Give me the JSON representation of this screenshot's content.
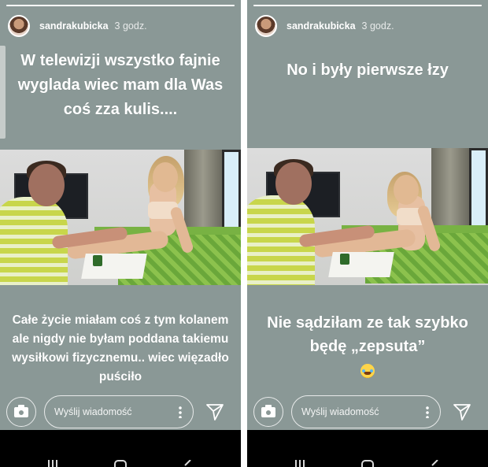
{
  "stories": [
    {
      "username": "sandrakubicka",
      "time": "3 godz.",
      "progress": 1.0,
      "caption_top": "W telewizji wszystko fajnie wyglada wiec mam dla Was coś zza kulis....",
      "caption_bottom": "Całe życie miałam coś z tym kolanem ale nigdy nie byłam poddana takiemu wysiłkowi fizycznemu.. wiec więzadło puściło",
      "reply_placeholder": "Wyślij wiadomość"
    },
    {
      "username": "sandrakubicka",
      "time": "3 godz.",
      "progress": 1.0,
      "caption_top": "No i były pierwsze łzy",
      "caption_bottom": "Nie sądziłam ze tak szybko będę „zepsuta”",
      "caption_bottom_emoji": "face-with-tears-of-joy-icon",
      "reply_placeholder": "Wyślij wiadomość"
    }
  ],
  "icons": {
    "camera": "camera-icon",
    "more": "more-vertical-icon",
    "send": "send-icon",
    "nav_recent": "recent-apps-icon",
    "nav_home": "home-icon",
    "nav_back": "back-icon"
  },
  "colors": {
    "story_background": "#8a9896",
    "text": "#ffffff",
    "nav_bar": "#000000"
  }
}
